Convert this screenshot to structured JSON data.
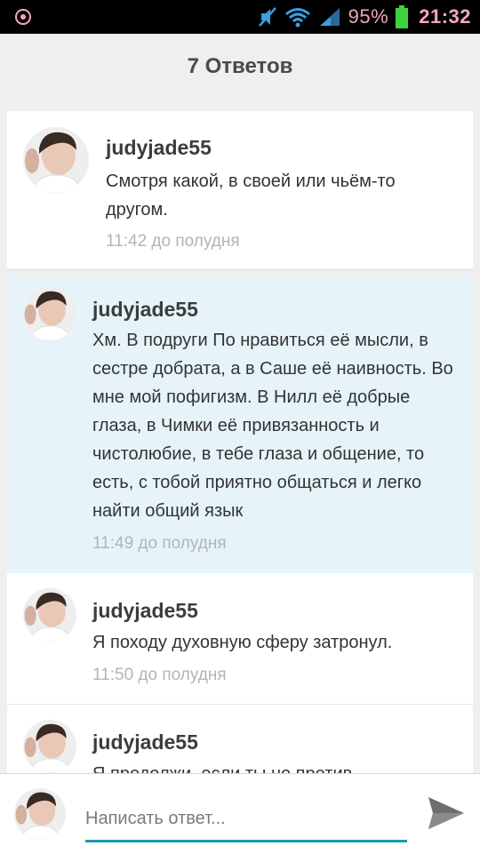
{
  "status_bar": {
    "battery_percent": "95%",
    "time": "21:32",
    "icons": [
      "notification-icon",
      "mute-icon",
      "wifi-icon",
      "signal-icon",
      "battery-icon"
    ]
  },
  "header": {
    "title": "7 Ответов"
  },
  "replies": [
    {
      "username": "judyjade55",
      "text": "Смотря какой, в своей или чьём-то другом.",
      "time": "11:42 до полудня"
    },
    {
      "username": "judyjade55",
      "text": "Хм. В подруги По нравиться её мысли, в сестре добрата, а в Саше её наивность. Во мне мой пофигизм. В Нилл её добрые глаза, в Чимки её привязанность и чистолюбие, в тебе глаза и общение, то есть, с тобой приятно общаться и легко найти общий язык",
      "time": "11:49 до полудня"
    },
    {
      "username": "judyjade55",
      "text": "Я походу духовную сферу затронул.",
      "time": "11:50 до полудня"
    },
    {
      "username": "judyjade55",
      "text": "Я продолжи, если ты не против",
      "time": ""
    }
  ],
  "composer": {
    "placeholder": "Написать ответ...",
    "value": ""
  },
  "colors": {
    "accent": "#1c9bb0",
    "highlight": "#e6f4fa",
    "status_text": "#f2a6b6"
  }
}
